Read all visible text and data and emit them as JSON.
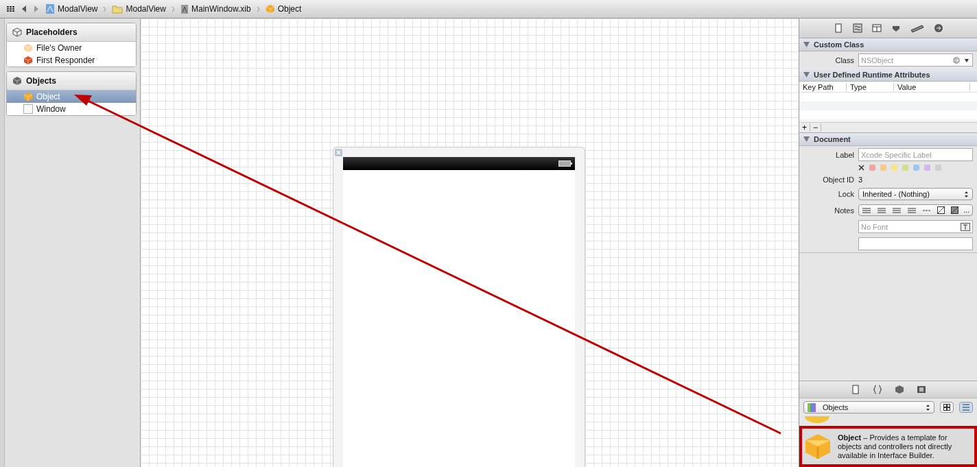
{
  "breadcrumbs": [
    {
      "label": "ModalView",
      "kind": "project"
    },
    {
      "label": "ModalView",
      "kind": "folder"
    },
    {
      "label": "MainWindow.xib",
      "kind": "xib"
    },
    {
      "label": "Object",
      "kind": "object"
    }
  ],
  "outline": [
    {
      "title": "Placeholders",
      "kind": "placeholders",
      "items": [
        {
          "label": "File's Owner",
          "kind": "owner",
          "selected": false
        },
        {
          "label": "First Responder",
          "kind": "responder",
          "selected": false
        }
      ]
    },
    {
      "title": "Objects",
      "kind": "objects",
      "items": [
        {
          "label": "Object",
          "kind": "object",
          "selected": true
        },
        {
          "label": "Window",
          "kind": "window",
          "selected": false
        }
      ]
    }
  ],
  "custom_class": {
    "title": "Custom Class",
    "class_label": "Class",
    "class_placeholder": "NSObject"
  },
  "runtime_attributes": {
    "title": "User Defined Runtime Attributes",
    "columns": [
      "Key Path",
      "Type",
      "Value"
    ],
    "add": "+",
    "remove": "−"
  },
  "document": {
    "title": "Document",
    "label_label": "Label",
    "label_placeholder": "Xcode Specific Label",
    "swatches": [
      {
        "color": "#f4a3a3"
      },
      {
        "color": "#f7c98a"
      },
      {
        "color": "#f5e48c"
      },
      {
        "color": "#cde08e"
      },
      {
        "color": "#9cc7f2"
      },
      {
        "color": "#d5b8ec"
      },
      {
        "color": "#cfcfcf"
      }
    ],
    "object_id_label": "Object ID",
    "object_id": "3",
    "lock_label": "Lock",
    "lock_value": "Inherited - (Nothing)",
    "notes_label": "Notes",
    "notes_more": "...",
    "font_placeholder": "No Font"
  },
  "library": {
    "filter": "Objects",
    "view_buttons": [
      {
        "kind": "grid",
        "selected": false
      },
      {
        "kind": "list",
        "selected": true
      }
    ],
    "items": [
      {
        "text": "**Object** – Provides a template for objects and controllers not directly available in Interface Builder.",
        "highlighted": true
      }
    ]
  }
}
